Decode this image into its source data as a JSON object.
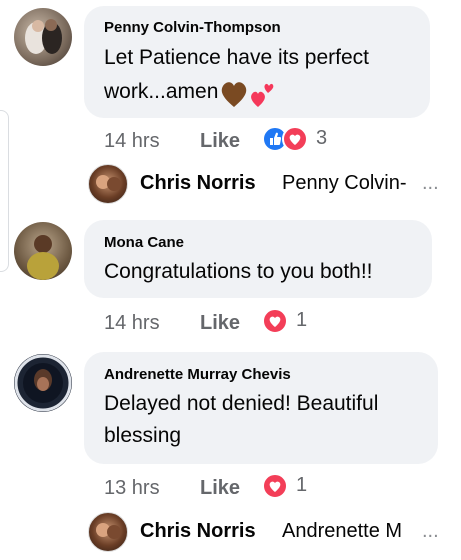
{
  "colors": {
    "bubble": "#f0f2f5",
    "meta_gray": "#65676b",
    "love_red": "#f33e58",
    "like_blue": "#2078f4"
  },
  "comments": [
    {
      "author": "Penny Colvin-Thompson",
      "text_line1": "Let Patience have its perfect",
      "text_line2": "work...amen",
      "emojis": [
        "brown-heart-icon",
        "two-hearts-icon"
      ],
      "time": "14 hrs",
      "like_label": "Like",
      "reactions": [
        "like-reaction-icon",
        "love-reaction-icon"
      ],
      "reaction_count": "3",
      "reply": {
        "name": "Chris Norris",
        "preview": "Penny Colvin-",
        "ellipsis": "..."
      }
    },
    {
      "author": "Mona Cane",
      "text_line1": "Congratulations to you both!!",
      "time": "14 hrs",
      "like_label": "Like",
      "reactions": [
        "love-reaction-icon"
      ],
      "reaction_count": "1"
    },
    {
      "author": "Andrenette Murray Chevis",
      "text_line1": "Delayed not denied! Beautiful",
      "text_line2": "blessing",
      "time": "13 hrs",
      "like_label": "Like",
      "reactions": [
        "love-reaction-icon"
      ],
      "reaction_count": "1",
      "reply": {
        "name": "Chris Norris",
        "preview": "Andrenette M",
        "ellipsis": "..."
      }
    }
  ]
}
